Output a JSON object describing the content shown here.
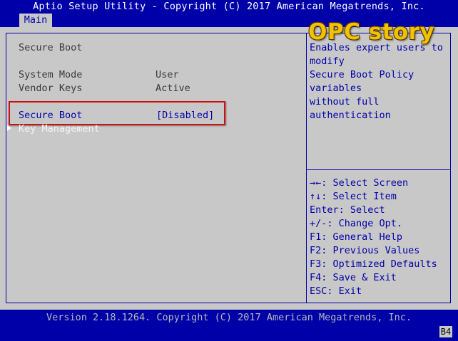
{
  "header": {
    "title": "Aptio Setup Utility - Copyright (C) 2017 American Megatrends, Inc.",
    "tab_main": "Main"
  },
  "watermark": "OPC story",
  "left": {
    "section_title": "Secure Boot",
    "rows": [
      {
        "label": "System Mode",
        "value": "User"
      },
      {
        "label": "Vendor Keys",
        "value": "Active"
      }
    ],
    "secure_boot": {
      "label": "Secure Boot",
      "value": "[Disabled]"
    },
    "key_management": "Key Management"
  },
  "help": {
    "lines": [
      "Enables expert users to",
      "modify",
      "Secure Boot Policy",
      "variables",
      "without full",
      "authentication"
    ]
  },
  "keys": [
    "→←: Select Screen",
    "↑↓: Select Item",
    "Enter: Select",
    "+/-: Change Opt.",
    "F1: General Help",
    "F2: Previous Values",
    "F3: Optimized Defaults",
    "F4: Save & Exit",
    "ESC: Exit"
  ],
  "footer": {
    "version": "Version 2.18.1264. Copyright (C) 2017 American Megatrends, Inc.",
    "code": "B4"
  }
}
